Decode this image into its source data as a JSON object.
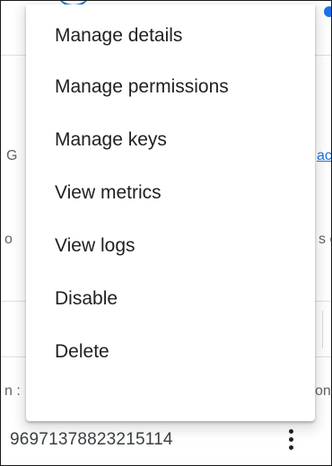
{
  "menu": {
    "items": [
      {
        "label": "Manage details"
      },
      {
        "label": "Manage permissions"
      },
      {
        "label": "Manage keys"
      },
      {
        "label": "View metrics"
      },
      {
        "label": "View logs"
      },
      {
        "label": "Disable"
      },
      {
        "label": "Delete"
      }
    ]
  },
  "background": {
    "left_fragment_1": "G",
    "left_fragment_2": "o",
    "left_fragment_3": "n :",
    "right_link_fragment": "ac",
    "right_fragment_2": "s e",
    "right_fragment_3": "on"
  },
  "row": {
    "id": "96971378823215114"
  },
  "colors": {
    "accent": "#1a73e8",
    "text": "#202124",
    "divider": "#e0e0e0"
  },
  "icons": {
    "row_actions": "more-vert-icon"
  }
}
